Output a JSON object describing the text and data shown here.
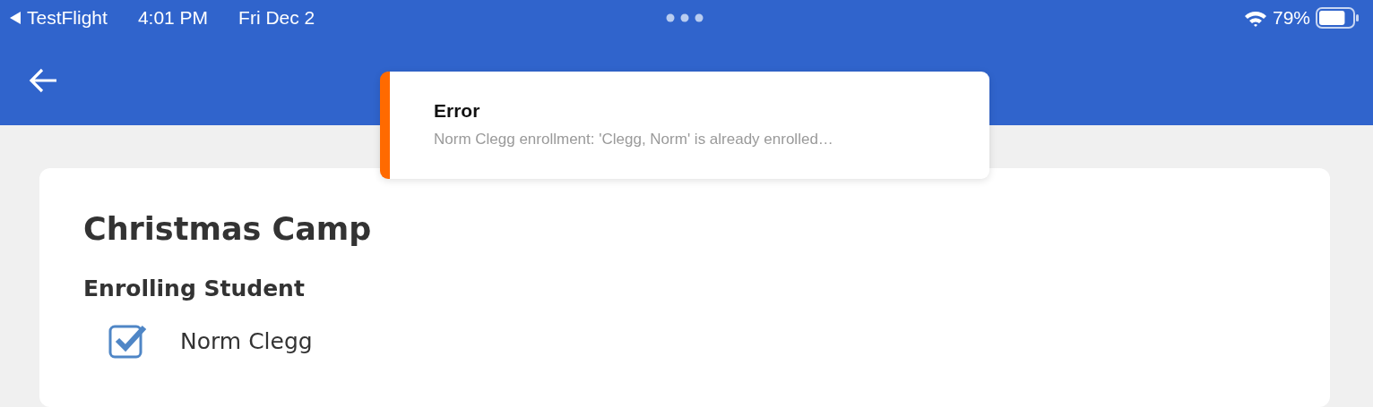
{
  "status_bar": {
    "back_app": "TestFlight",
    "time": "4:01 PM",
    "date": "Fri Dec 2",
    "battery": "79%"
  },
  "toast": {
    "title": "Error",
    "message": "Norm Clegg enrollment: 'Clegg, Norm' is already enrolled…"
  },
  "card": {
    "title": "Christmas Camp",
    "section": "Enrolling Student",
    "students": [
      {
        "name": "Norm Clegg",
        "checked": true
      }
    ]
  }
}
